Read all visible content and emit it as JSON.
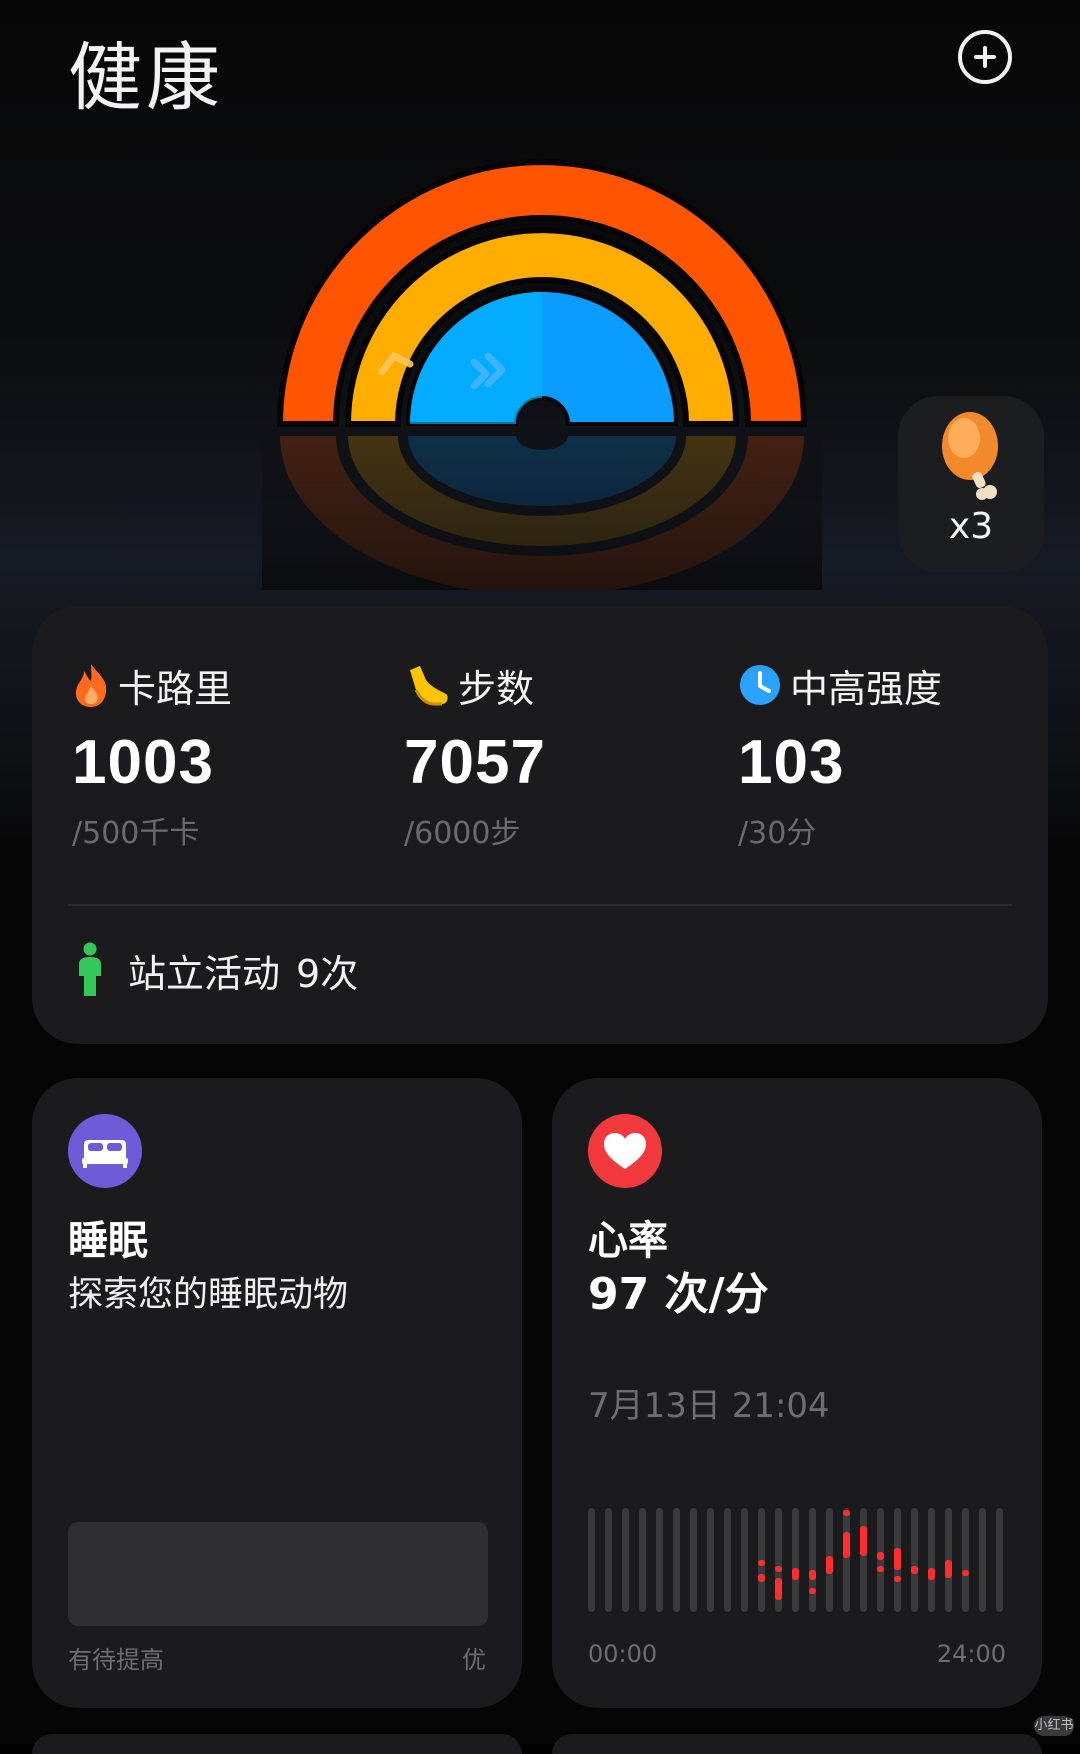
{
  "header": {
    "title": "健康",
    "add_icon": "plus-circle-icon"
  },
  "activity_rings": {
    "colors": {
      "calories": "#ff5500",
      "steps": "#ffae00",
      "intensity": "#0a9cff"
    },
    "icons": [
      "arrow-icon",
      "double-chevron-icon"
    ]
  },
  "reward": {
    "icon": "drumstick-icon",
    "count": "x3"
  },
  "summary": {
    "calories": {
      "label": "卡路里",
      "value": "1003",
      "target": "/500千卡",
      "icon": "flame-icon",
      "color": "#ff6a1f"
    },
    "steps": {
      "label": "步数",
      "value": "7057",
      "target": "/6000步",
      "icon": "shoe-icon",
      "color": "#ffc400"
    },
    "intensity": {
      "label": "中高强度",
      "value": "103",
      "target": "/30分",
      "icon": "clock-icon",
      "color": "#2aa2ff"
    },
    "stand": {
      "label": "站立活动",
      "value": "9次",
      "icon": "person-icon",
      "color": "#34c759"
    }
  },
  "sleep": {
    "title": "睡眠",
    "subtitle": "探索您的睡眠动物",
    "icon": "bed-icon",
    "icon_color": "#6e5bd8",
    "scale_low": "有待提高",
    "scale_high": "优"
  },
  "heart_rate": {
    "title": "心率",
    "value": "97 次/分",
    "time": "7月13日 21:04",
    "icon": "heart-icon",
    "icon_color": "#f2393d",
    "x_start": "00:00",
    "x_end": "24:00"
  },
  "watermark": "小红书"
}
